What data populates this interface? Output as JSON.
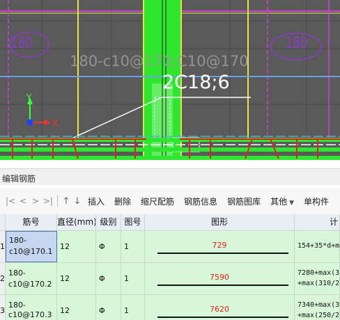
{
  "cad": {
    "slab_left_label": "180",
    "slab_right_label": "180",
    "rebar_label": "180-c10@170;C10@170",
    "beam_label": "2C18;6",
    "axis_y": "Y",
    "axis_x": "X",
    "colors": {
      "background": "#5a5a5a",
      "beam": "#2ee62e",
      "grid_yellow": "#e6e64a",
      "grid_blue": "#6aa0e6",
      "slab_label": "#8a3cc8",
      "rebar_red": "#e02020"
    }
  },
  "panel": {
    "title": "编辑钢筋"
  },
  "toolbar": {
    "first": "|<",
    "prev": "<",
    "next": ">",
    "last": ">|",
    "move_up_icon": "arrow-up-icon",
    "move_down_icon": "arrow-down-icon",
    "insert": "插入",
    "delete": "删除",
    "scale_rebar": "缩尺配筋",
    "rebar_info": "钢筋信息",
    "rebar_library": "钢筋图库",
    "other": "其他",
    "single_member": "单构件"
  },
  "table": {
    "headers": {
      "name": "筋号",
      "diameter": "直径(mm)",
      "grade": "级别",
      "figure_no": "图号",
      "shape": "图形",
      "formula": "计"
    },
    "rows": [
      {
        "row_no": "1",
        "name_line1": "180-",
        "name_line2": "c10@170.1",
        "diameter": "12",
        "grade": "Φ",
        "figure_no": "1",
        "shape_value": "729",
        "formula_line1": "154+35*d+m",
        "formula_line2": ""
      },
      {
        "row_no": "2",
        "name_line1": "180-",
        "name_line2": "c10@170.2",
        "diameter": "12",
        "grade": "Φ",
        "figure_no": "1",
        "shape_value": "7590",
        "formula_line1": "7280+max(3",
        "formula_line2": "+max(310/2"
      },
      {
        "row_no": "3",
        "name_line1": "180-",
        "name_line2": "c10@170.3",
        "diameter": "12",
        "grade": "Φ",
        "figure_no": "1",
        "shape_value": "7620",
        "formula_line1": "7340+max(3",
        "formula_line2": "+max(250/2"
      }
    ]
  }
}
